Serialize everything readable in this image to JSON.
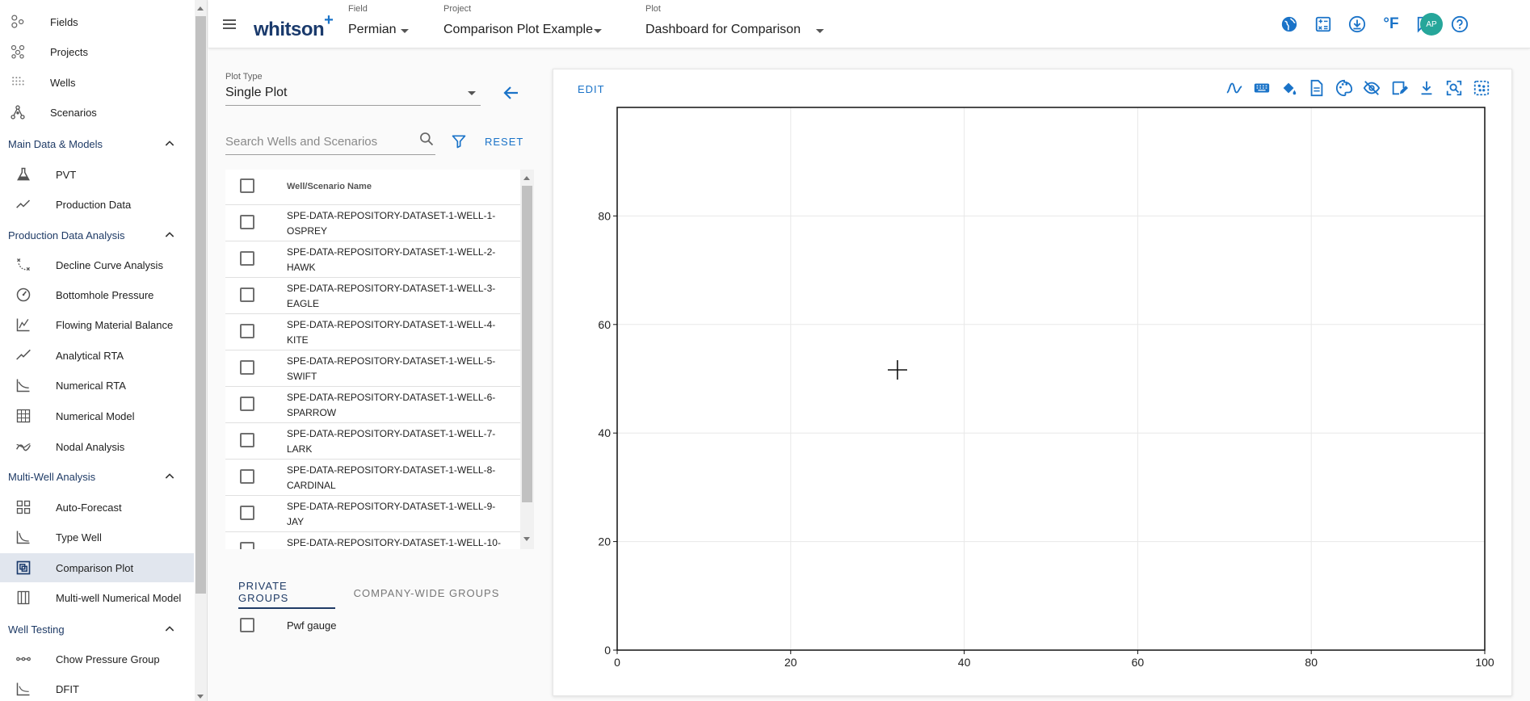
{
  "sidebar": {
    "top_items": [
      {
        "label": "Fields",
        "icon": "fields-icon"
      },
      {
        "label": "Projects",
        "icon": "projects-icon"
      },
      {
        "label": "Wells",
        "icon": "wells-icon"
      },
      {
        "label": "Scenarios",
        "icon": "scenarios-icon"
      }
    ],
    "sections": [
      {
        "title": "Main Data & Models",
        "items": [
          {
            "label": "PVT",
            "icon": "flask-icon"
          },
          {
            "label": "Production Data",
            "icon": "trend-line-icon"
          }
        ]
      },
      {
        "title": "Production Data Analysis",
        "items": [
          {
            "label": "Decline Curve Analysis",
            "icon": "decline-curve-icon"
          },
          {
            "label": "Bottomhole Pressure",
            "icon": "gauge-icon"
          },
          {
            "label": "Flowing Material Balance",
            "icon": "material-balance-icon"
          },
          {
            "label": "Analytical RTA",
            "icon": "analytical-rta-icon"
          },
          {
            "label": "Numerical RTA",
            "icon": "numerical-rta-icon"
          },
          {
            "label": "Numerical Model",
            "icon": "grid-model-icon"
          },
          {
            "label": "Nodal Analysis",
            "icon": "nodal-analysis-icon"
          }
        ]
      },
      {
        "title": "Multi-Well Analysis",
        "items": [
          {
            "label": "Auto-Forecast",
            "icon": "auto-forecast-icon"
          },
          {
            "label": "Type Well",
            "icon": "type-well-icon"
          },
          {
            "label": "Comparison Plot",
            "icon": "comparison-plot-icon",
            "active": true
          },
          {
            "label": "Multi-well Numerical Model",
            "icon": "multiwell-model-icon"
          }
        ]
      },
      {
        "title": "Well Testing",
        "items": [
          {
            "label": "Chow Pressure Group",
            "icon": "chow-pressure-icon"
          },
          {
            "label": "DFIT",
            "icon": "dfit-icon"
          }
        ]
      }
    ]
  },
  "topbar": {
    "logo": "whitson",
    "logo_plus": "+",
    "field": {
      "label": "Field",
      "value": "Permian"
    },
    "project": {
      "label": "Project",
      "value": "Comparison Plot Example"
    },
    "plot": {
      "label": "Plot",
      "value": "Dashboard for Comparison"
    },
    "icons": [
      "globe-icon",
      "calculator-icon",
      "download-circle-icon",
      "temperature-unit-icon",
      "feedback-icon",
      "help-icon"
    ],
    "temperature_unit": "°F",
    "avatar": "AP"
  },
  "panel": {
    "plot_type_label": "Plot Type",
    "plot_type_value": "Single Plot",
    "search_placeholder": "Search Wells and Scenarios",
    "reset_label": "RESET",
    "column_header": "Well/Scenario Name",
    "wells": [
      "SPE-DATA-REPOSITORY-DATASET-1-WELL-1-OSPREY",
      "SPE-DATA-REPOSITORY-DATASET-1-WELL-2-HAWK",
      "SPE-DATA-REPOSITORY-DATASET-1-WELL-3-EAGLE",
      "SPE-DATA-REPOSITORY-DATASET-1-WELL-4-KITE",
      "SPE-DATA-REPOSITORY-DATASET-1-WELL-5-SWIFT",
      "SPE-DATA-REPOSITORY-DATASET-1-WELL-6-SPARROW",
      "SPE-DATA-REPOSITORY-DATASET-1-WELL-7-LARK",
      "SPE-DATA-REPOSITORY-DATASET-1-WELL-8-CARDINAL",
      "SPE-DATA-REPOSITORY-DATASET-1-WELL-9-JAY",
      "SPE-DATA-REPOSITORY-DATASET-1-WELL-10-"
    ],
    "group_tabs": [
      "PRIVATE GROUPS",
      "COMPANY-WIDE GROUPS"
    ],
    "groups": [
      "Pwf gauge"
    ]
  },
  "plot_card": {
    "edit_label": "EDIT",
    "tool_icons": [
      "curve-icon",
      "keyboard-icon",
      "fill-color-icon",
      "document-icon",
      "palette-icon",
      "hide-icon",
      "edit-note-icon",
      "download-icon",
      "zoom-fit-icon",
      "scatter-select-icon"
    ]
  },
  "chart_data": {
    "type": "scatter",
    "series": [],
    "x": [],
    "title": "",
    "xlabel": "",
    "ylabel": "",
    "xlim": [
      0,
      100
    ],
    "ylim": [
      0,
      100
    ],
    "xticks": [
      "0",
      "20",
      "40",
      "60",
      "80",
      "100"
    ],
    "yticks": [
      "0",
      "20",
      "40",
      "60",
      "80"
    ],
    "grid": true
  }
}
